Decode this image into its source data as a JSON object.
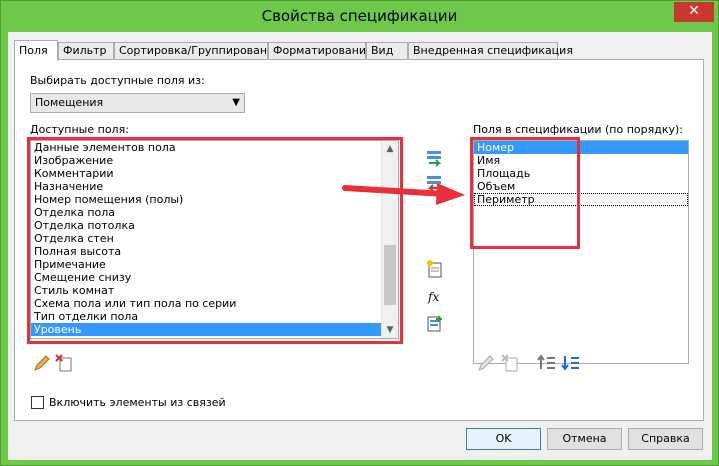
{
  "window": {
    "title": "Свойства спецификации",
    "close_label": "✕"
  },
  "tabs": [
    {
      "label": "Поля",
      "active": true
    },
    {
      "label": "Фильтр",
      "active": false
    },
    {
      "label": "Сортировка/Группирование",
      "active": false
    },
    {
      "label": "Форматирование",
      "active": false
    },
    {
      "label": "Вид",
      "active": false
    },
    {
      "label": "Внедренная спецификация",
      "active": false
    }
  ],
  "fields_tab": {
    "select_from_label": "Выбирать доступные поля из:",
    "select_from_value": "Помещения",
    "available_label": "Доступные поля:",
    "available_fields": [
      "Данные элементов пола",
      "Изображение",
      "Комментарии",
      "Назначение",
      "Номер помещения (полы)",
      "Отделка пола",
      "Отделка потолка",
      "Отделка стен",
      "Полная высота",
      "Примечание",
      "Смещение снизу",
      "Стиль комнат",
      "Схема пола или тип пола по серии",
      "Тип отделки пола",
      "Уровень"
    ],
    "available_selected": "Уровень",
    "scheduled_label": "Поля в спецификации (по порядку):",
    "scheduled_fields": [
      "Номер",
      "Имя",
      "Площадь",
      "Объем",
      "Периметр"
    ],
    "scheduled_selected": "Номер",
    "scheduled_focused": "Периметр",
    "include_links_label": "Включить элементы из связей",
    "include_links_checked": false
  },
  "buttons": {
    "ok": "OK",
    "cancel": "Отмена",
    "help": "Справка"
  },
  "colors": {
    "titlebar": "#6ec84a",
    "annotation_red": "#e8303a",
    "selection": "#3399ff"
  }
}
